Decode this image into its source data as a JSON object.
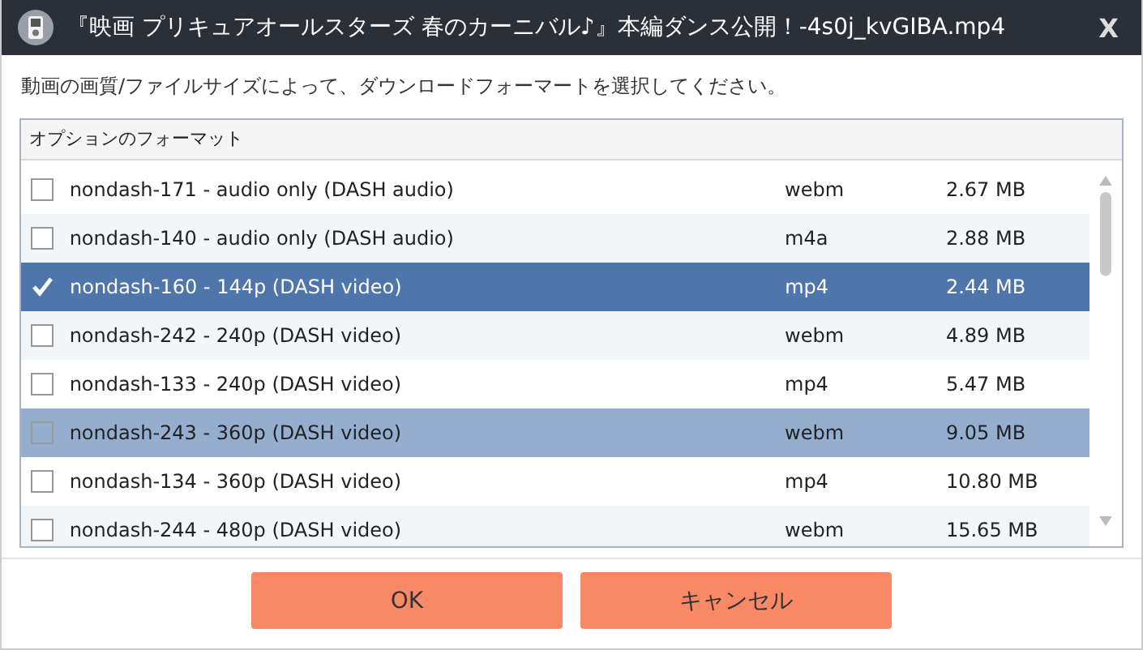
{
  "window": {
    "title": "『映画 プリキュアオールスターズ 春のカーニバル♪』本編ダンス公開！-4s0j_kvGIBA.mp4",
    "close": "X"
  },
  "instruction": "動画の画質/ファイルサイズによって、ダウンロードフォーマートを選択してください。",
  "table": {
    "header": "オプションのフォーマット",
    "rows": [
      {
        "name": "nondash-171 - audio only (DASH audio)",
        "format": "webm",
        "size": "2.67 MB",
        "checked": false,
        "selected": false,
        "hovered": false
      },
      {
        "name": "nondash-140 - audio only (DASH audio)",
        "format": "m4a",
        "size": "2.88 MB",
        "checked": false,
        "selected": false,
        "hovered": false
      },
      {
        "name": "nondash-160 - 144p (DASH video)",
        "format": "mp4",
        "size": "2.44 MB",
        "checked": true,
        "selected": true,
        "hovered": false
      },
      {
        "name": "nondash-242 - 240p (DASH video)",
        "format": "webm",
        "size": "4.89 MB",
        "checked": false,
        "selected": false,
        "hovered": false
      },
      {
        "name": "nondash-133 - 240p (DASH video)",
        "format": "mp4",
        "size": "5.47 MB",
        "checked": false,
        "selected": false,
        "hovered": false
      },
      {
        "name": "nondash-243 - 360p (DASH video)",
        "format": "webm",
        "size": "9.05 MB",
        "checked": false,
        "selected": false,
        "hovered": true
      },
      {
        "name": "nondash-134 - 360p (DASH video)",
        "format": "mp4",
        "size": "10.80 MB",
        "checked": false,
        "selected": false,
        "hovered": false
      },
      {
        "name": "nondash-244 - 480p (DASH video)",
        "format": "webm",
        "size": "15.65 MB",
        "checked": false,
        "selected": false,
        "hovered": false
      }
    ]
  },
  "buttons": [
    {
      "label": "OK"
    },
    {
      "label": "キャンセル"
    }
  ]
}
